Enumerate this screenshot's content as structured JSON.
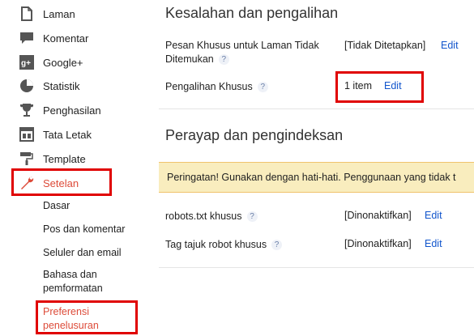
{
  "sidebar": {
    "items": [
      {
        "label": "Laman",
        "icon": "page-icon"
      },
      {
        "label": "Komentar",
        "icon": "comment-icon"
      },
      {
        "label": "Google+",
        "icon": "google-plus-icon"
      },
      {
        "label": "Statistik",
        "icon": "stats-icon"
      },
      {
        "label": "Penghasilan",
        "icon": "trophy-icon"
      },
      {
        "label": "Tata Letak",
        "icon": "layout-icon"
      },
      {
        "label": "Template",
        "icon": "paint-roller-icon"
      },
      {
        "label": "Setelan",
        "icon": "wrench-icon"
      }
    ],
    "subitems": [
      {
        "label": "Dasar"
      },
      {
        "label": "Pos dan komentar"
      },
      {
        "label": "Seluler dan email"
      },
      {
        "label": "Bahasa dan pemformatan"
      },
      {
        "label": "Preferensi penelusuran"
      }
    ]
  },
  "errors_section": {
    "title": "Kesalahan dan pengalihan",
    "rows": [
      {
        "label": "Pesan Khusus untuk Laman Tidak Ditemukan",
        "help": "?",
        "value": "[Tidak Ditetapkan]",
        "edit": "Edit"
      },
      {
        "label": "Pengalihan Khusus",
        "help": "?",
        "value": "1 item",
        "edit": "Edit"
      }
    ]
  },
  "crawl_section": {
    "title": "Perayap dan pengindeksan",
    "warning": "Peringatan! Gunakan dengan hati-hati. Penggunaan yang tidak t",
    "rows": [
      {
        "label": "robots.txt khusus",
        "help": "?",
        "value": "[Dinonaktifkan]",
        "edit": "Edit"
      },
      {
        "label": "Tag tajuk robot khusus",
        "help": "?",
        "value": "[Dinonaktifkan]",
        "edit": "Edit"
      }
    ]
  },
  "colors": {
    "accent": "#dd4b39",
    "link": "#1155cc",
    "highlight": "#e00000",
    "warning_bg": "#f9edbe"
  }
}
